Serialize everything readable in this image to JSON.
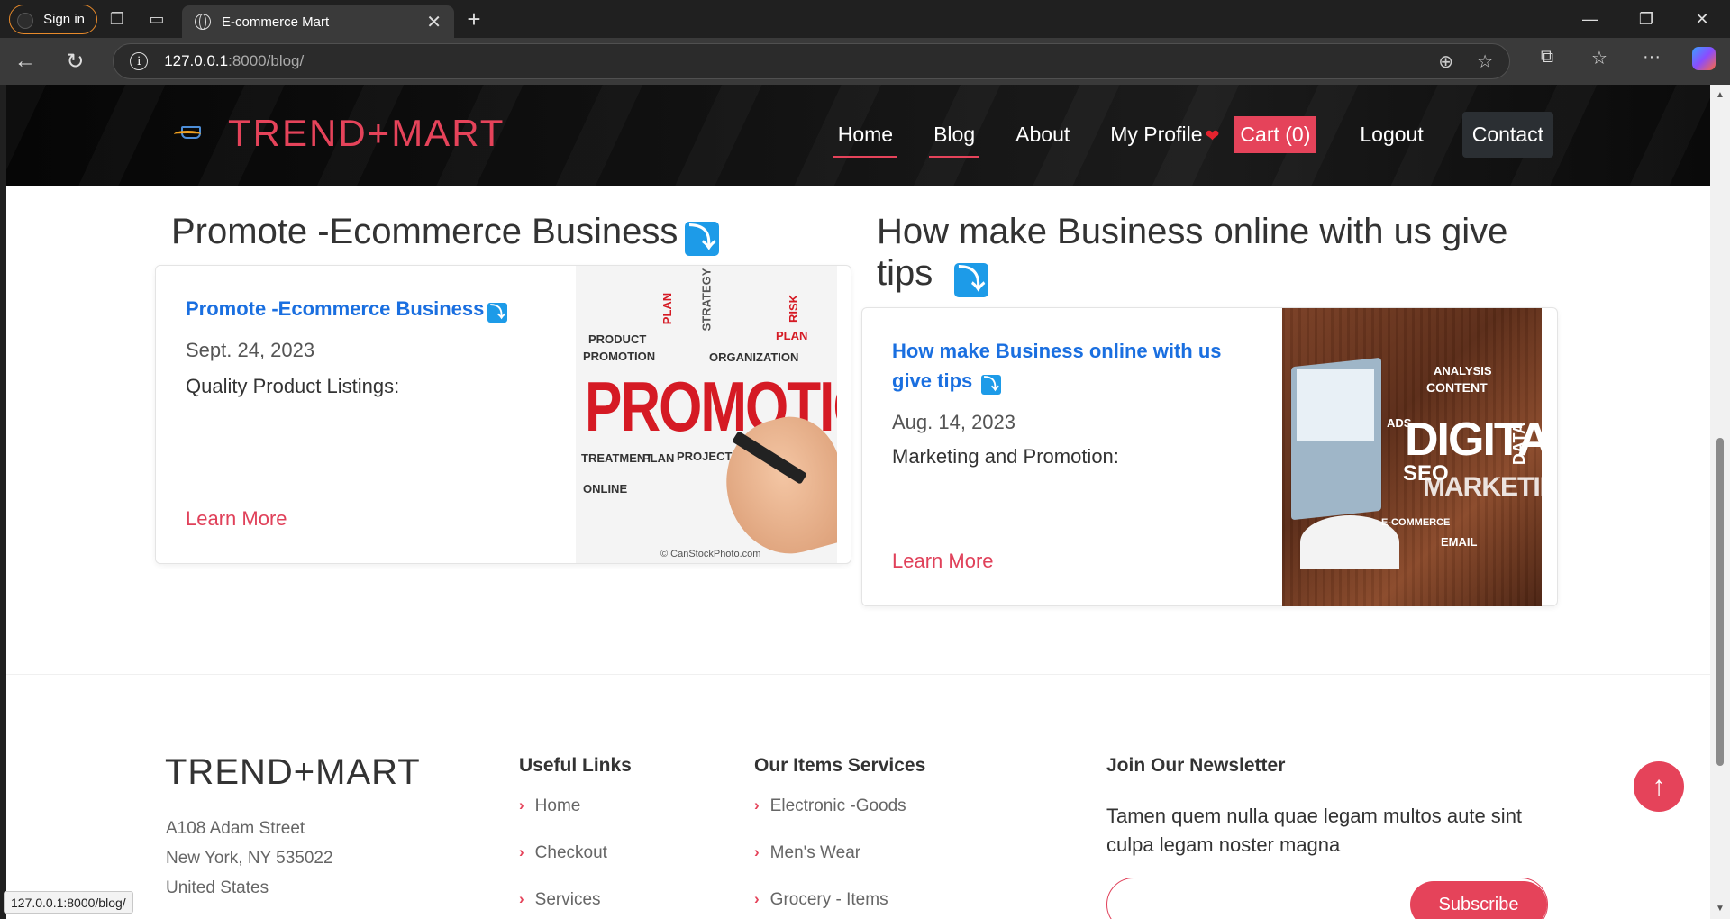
{
  "browser": {
    "signin_label": "Sign in",
    "tab_title": "E-commerce Mart",
    "url_host": "127.0.0.1",
    "url_path": ":8000/blog/",
    "status_url": "127.0.0.1:8000/blog/"
  },
  "site": {
    "brand": "TREND+MART",
    "nav": {
      "home": "Home",
      "blog": "Blog",
      "about": "About",
      "profile": "My Profile",
      "cart": "Cart (0)",
      "logout": "Logout",
      "contact": "Contact"
    },
    "accent_color": "#e5435a"
  },
  "posts": [
    {
      "heading": "Promote -Ecommerce Business",
      "title": "Promote -Ecommerce Business",
      "date": "Sept. 24, 2023",
      "excerpt": "Quality Product Listings:",
      "link": "Learn More",
      "image_credit": "© CanStockPhoto.com",
      "image_word": "PROMOTION"
    },
    {
      "heading_line1": "How make Business online with us give",
      "heading_line2": "tips",
      "title_line1": "How make Business online with us",
      "title_line2": "give tips",
      "date": "Aug. 14, 2023",
      "excerpt": "Marketing and Promotion:",
      "link": "Learn More",
      "image_word": "DIGITAL",
      "image_word2": "MARKETING"
    }
  ],
  "footer": {
    "brand": "TREND+MART",
    "address": [
      "A108 Adam Street",
      "New York, NY 535022",
      "United States"
    ],
    "useful_links": {
      "title": "Useful Links",
      "items": [
        "Home",
        "Checkout",
        "Services"
      ]
    },
    "services": {
      "title": "Our Items Services",
      "items": [
        "Electronic -Goods",
        "Men's Wear",
        "Grocery - Items"
      ]
    },
    "newsletter": {
      "title": "Join Our Newsletter",
      "text": "Tamen quem nulla quae legam multos aute sint culpa legam noster magna",
      "button": "Subscribe"
    }
  }
}
